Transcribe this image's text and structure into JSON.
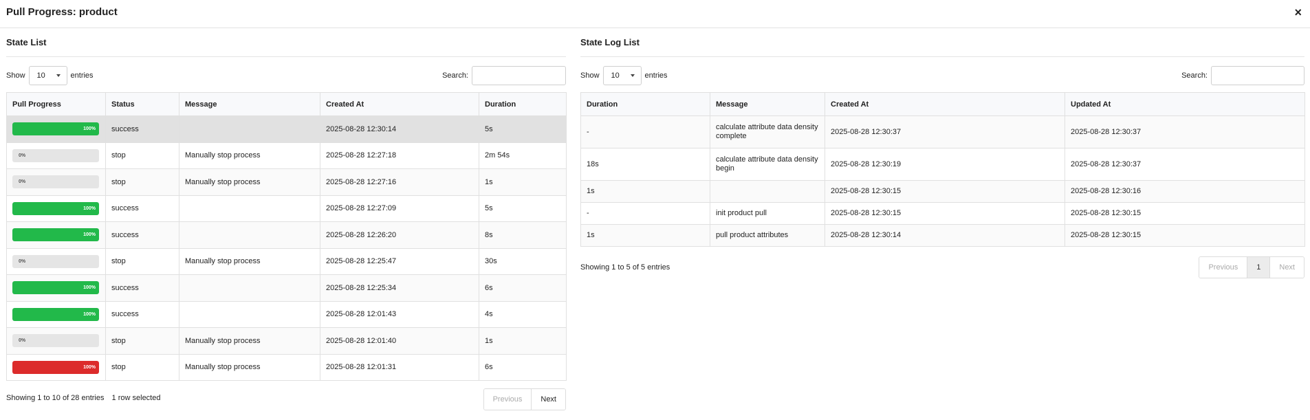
{
  "modal": {
    "title": "Pull Progress: product",
    "close_symbol": "×"
  },
  "state_list": {
    "title": "State List",
    "show_label": "Show",
    "entries_value": "10",
    "entries_label": "entries",
    "search_label": "Search:",
    "search_value": "",
    "columns": [
      "Pull Progress",
      "Status",
      "Message",
      "Created At",
      "Duration"
    ],
    "rows": [
      {
        "progress": "100%",
        "progress_state": "success",
        "status": "success",
        "message": "",
        "created_at": "2025-08-28 12:30:14",
        "duration": "5s",
        "selected": true
      },
      {
        "progress": "0%",
        "progress_state": "empty",
        "status": "stop",
        "message": "Manually stop process",
        "created_at": "2025-08-28 12:27:18",
        "duration": "2m 54s",
        "selected": false
      },
      {
        "progress": "0%",
        "progress_state": "empty",
        "status": "stop",
        "message": "Manually stop process",
        "created_at": "2025-08-28 12:27:16",
        "duration": "1s",
        "selected": false
      },
      {
        "progress": "100%",
        "progress_state": "success",
        "status": "success",
        "message": "",
        "created_at": "2025-08-28 12:27:09",
        "duration": "5s",
        "selected": false
      },
      {
        "progress": "100%",
        "progress_state": "success",
        "status": "success",
        "message": "",
        "created_at": "2025-08-28 12:26:20",
        "duration": "8s",
        "selected": false
      },
      {
        "progress": "0%",
        "progress_state": "empty",
        "status": "stop",
        "message": "Manually stop process",
        "created_at": "2025-08-28 12:25:47",
        "duration": "30s",
        "selected": false
      },
      {
        "progress": "100%",
        "progress_state": "success",
        "status": "success",
        "message": "",
        "created_at": "2025-08-28 12:25:34",
        "duration": "6s",
        "selected": false
      },
      {
        "progress": "100%",
        "progress_state": "success",
        "status": "success",
        "message": "",
        "created_at": "2025-08-28 12:01:43",
        "duration": "4s",
        "selected": false
      },
      {
        "progress": "0%",
        "progress_state": "empty",
        "status": "stop",
        "message": "Manually stop process",
        "created_at": "2025-08-28 12:01:40",
        "duration": "1s",
        "selected": false
      },
      {
        "progress": "100%",
        "progress_state": "danger",
        "status": "stop",
        "message": "Manually stop process",
        "created_at": "2025-08-28 12:01:31",
        "duration": "6s",
        "selected": false
      }
    ],
    "info": "Showing 1 to 10 of 28 entries",
    "selection_info": "1 row selected",
    "pagination": {
      "previous": "Previous",
      "next": "Next"
    }
  },
  "state_log_list": {
    "title": "State Log List",
    "show_label": "Show",
    "entries_value": "10",
    "entries_label": "entries",
    "search_label": "Search:",
    "search_value": "",
    "columns": [
      "Duration",
      "Message",
      "Created At",
      "Updated At"
    ],
    "rows": [
      {
        "duration": "-",
        "message": "calculate attribute data density complete",
        "created_at": "2025-08-28 12:30:37",
        "updated_at": "2025-08-28 12:30:37"
      },
      {
        "duration": "18s",
        "message": "calculate attribute data density begin",
        "created_at": "2025-08-28 12:30:19",
        "updated_at": "2025-08-28 12:30:37"
      },
      {
        "duration": "1s",
        "message": "",
        "created_at": "2025-08-28 12:30:15",
        "updated_at": "2025-08-28 12:30:16"
      },
      {
        "duration": "-",
        "message": "init product pull",
        "created_at": "2025-08-28 12:30:15",
        "updated_at": "2025-08-28 12:30:15"
      },
      {
        "duration": "1s",
        "message": "pull product attributes",
        "created_at": "2025-08-28 12:30:14",
        "updated_at": "2025-08-28 12:30:15"
      }
    ],
    "info": "Showing 1 to 5 of 5 entries",
    "pagination": {
      "previous": "Previous",
      "current": "1",
      "next": "Next"
    }
  },
  "colors": {
    "success": "#22b94a",
    "danger": "#dc2b2b",
    "track": "#e5e5e5",
    "selected_row": "#e1e1e1"
  },
  "icons": {
    "close": "close-icon",
    "dropdown": "chevron-down-icon"
  }
}
